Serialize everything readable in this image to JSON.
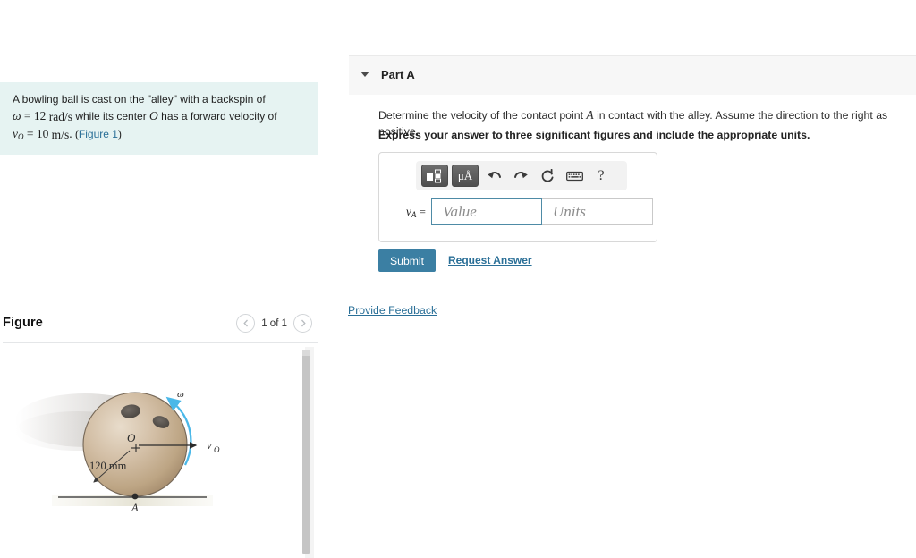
{
  "problem": {
    "line1_pre": "A bowling ball is cast on the \"alley\" with a backspin of",
    "omega_symbol": "ω",
    "omega_eq": "=",
    "omega_value": "12",
    "omega_units_num": "rad",
    "omega_units_den": "s",
    "line2_mid": "while its center",
    "center_symbol": "O",
    "line2_end": "has a forward velocity of",
    "v_symbol": "v",
    "v_subscript": "O",
    "v_eq": "=",
    "v_value": "10",
    "v_units_num": "m",
    "v_units_den": "s",
    "period": ".",
    "figure_link_open": "(",
    "figure_link": "Figure 1",
    "figure_link_close": ")"
  },
  "figure_panel": {
    "title": "Figure",
    "counter": "1 of 1",
    "prev_icon": "chevron-left-icon",
    "next_icon": "chevron-right-icon"
  },
  "figure": {
    "omega_label": "ω",
    "center_label": "O",
    "radius_label": "120 mm",
    "velocity_label": "v",
    "velocity_subscript": "O",
    "contact_point_label": "A",
    "ball_color": "#cbb49c",
    "ball_shade_color": "#a58d74",
    "omega_arrow_color": "#4bb8e8",
    "hole_color": "#5a5550"
  },
  "part_a": {
    "title": "Part A",
    "toggle_icon": "caret-down-icon",
    "question_pre": "Determine the velocity of the contact point",
    "question_point": "A",
    "question_post": "in contact with the alley. Assume the direction to the right as positive.",
    "instruction": "Express your answer to three significant figures and include the appropriate units."
  },
  "answer": {
    "label_symbol": "v",
    "label_subscript": "A",
    "label_eq": "=",
    "value_placeholder": "Value",
    "units_placeholder": "Units",
    "toolbar": [
      {
        "name": "template-icon",
        "glyph": ""
      },
      {
        "name": "units-mu-angstrom-icon",
        "glyph": "μÅ"
      },
      {
        "name": "undo-icon",
        "glyph": "↰"
      },
      {
        "name": "redo-icon",
        "glyph": "↱"
      },
      {
        "name": "reset-icon",
        "glyph": "↻"
      },
      {
        "name": "keyboard-icon",
        "glyph": "⌨"
      },
      {
        "name": "help-icon",
        "glyph": "?"
      }
    ]
  },
  "actions": {
    "submit_label": "Submit",
    "request_answer_label": "Request Answer",
    "provide_feedback_label": "Provide Feedback"
  },
  "colors": {
    "accent_blue": "#3b7fa3",
    "link_blue": "#2a6f97",
    "problem_bg": "#e6f3f2",
    "header_bg": "#f7f7f7"
  }
}
